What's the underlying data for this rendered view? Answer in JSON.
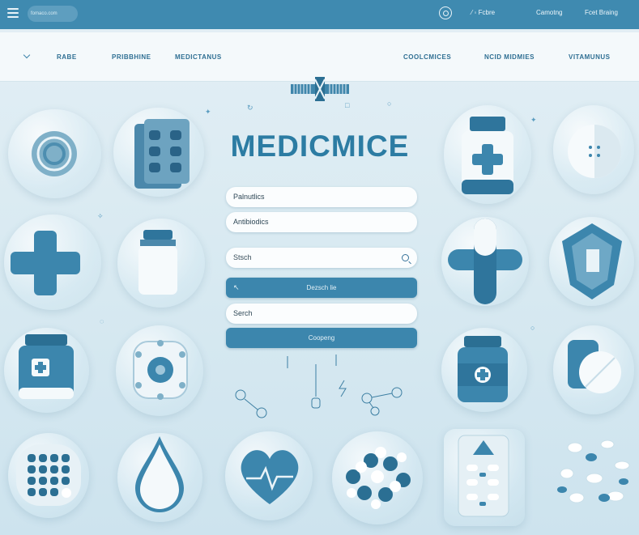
{
  "topbar": {
    "url_text": "fomaco.com",
    "links": [
      "Fcbre",
      "Camotng",
      "Fcet Braing"
    ]
  },
  "nav": {
    "left": [
      "RABE",
      "PRIBBHINE",
      "MEDICTANUS"
    ],
    "right": [
      "COOLCMICES",
      "NCID MIDMIES",
      "VITAMUNUS"
    ]
  },
  "title": "MEDICMICE",
  "form": {
    "field1": "Palnutlics",
    "field2": "Antibiodics",
    "search_placeholder": "Stsch",
    "search_button": "Dezsch lie",
    "field4": "Serch",
    "submit_button": "Coopeng"
  },
  "icons": [
    "ring-pill-icon",
    "blister-pack-icon",
    "pill-bottle-plus-icon",
    "half-pill-icon",
    "cross-icon",
    "pill-bottle-icon",
    "capsule-cross-icon",
    "shield-gem-icon",
    "medicine-jar-icon",
    "gear-pill-icon",
    "bottle-cross-icon",
    "half-tablet-icon",
    "pill-grid-icon",
    "drop-icon",
    "heart-pulse-icon",
    "pills-cluster-icon",
    "blister-card-icon",
    "scattered-pills-icon"
  ],
  "colors": {
    "accent": "#3c86ad",
    "dark": "#2b6f93",
    "bg": "#dcecf3"
  }
}
